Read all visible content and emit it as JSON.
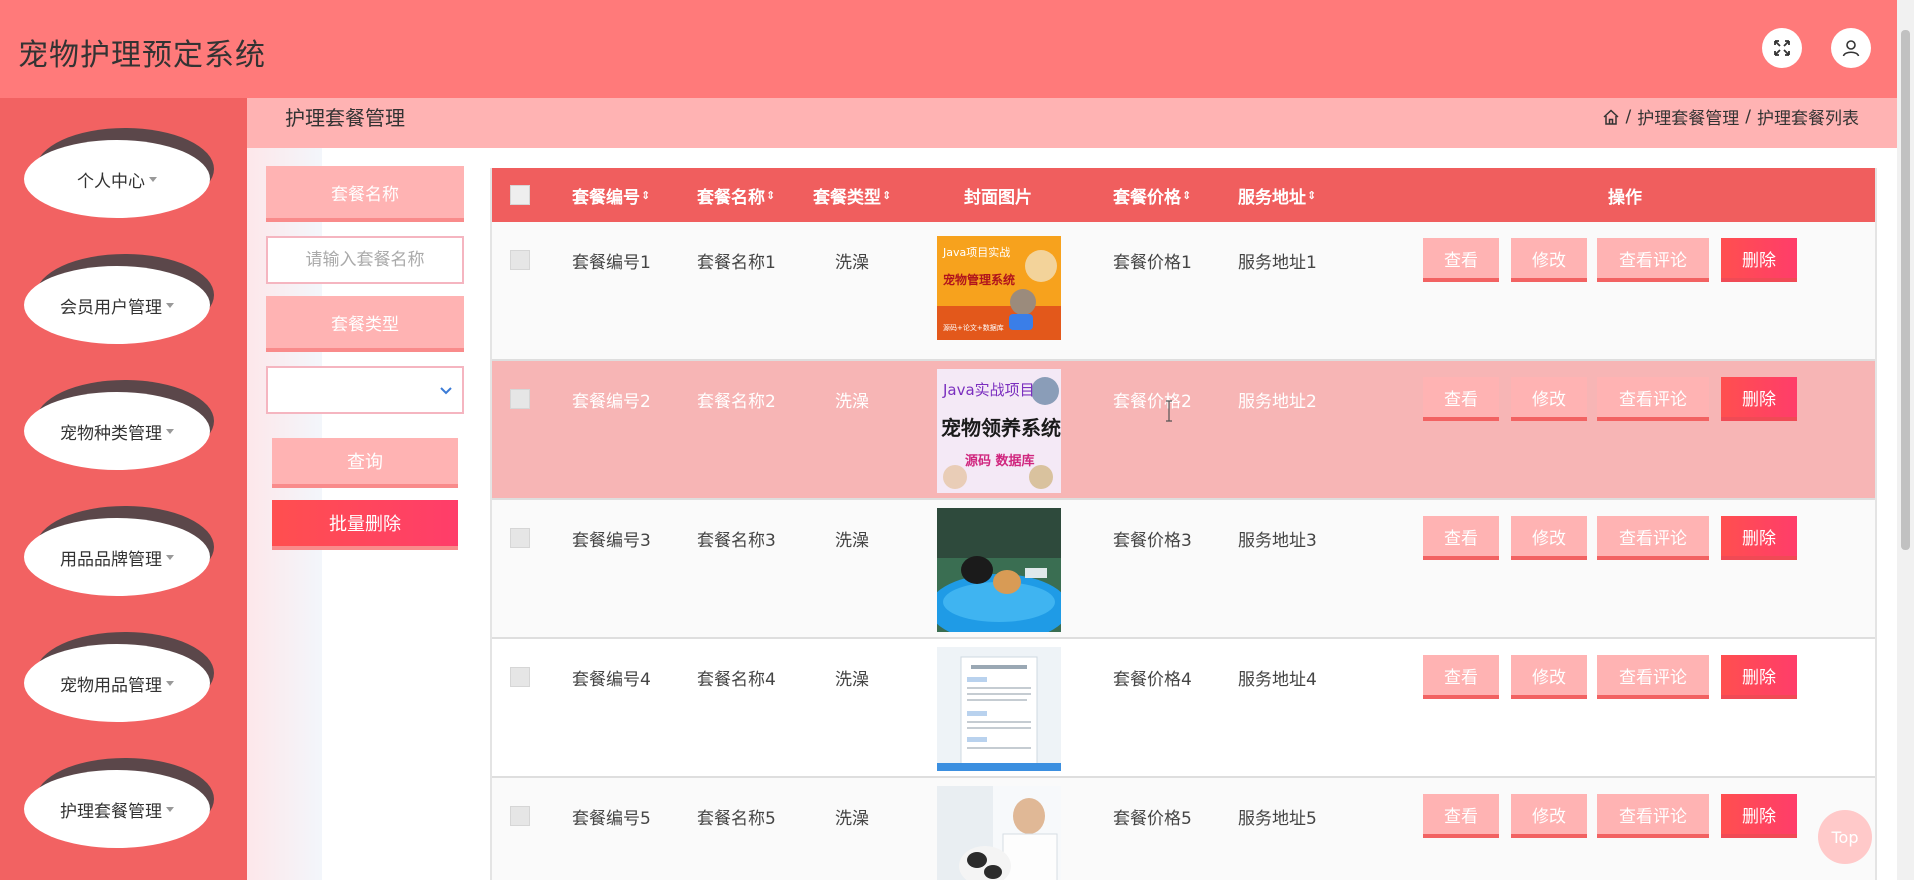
{
  "app": {
    "title": "宠物护理预定系统"
  },
  "header": {
    "fullscreen_icon": "fullscreen-icon",
    "user_icon": "user-icon"
  },
  "sidebar": {
    "items": [
      {
        "label": "个人中心"
      },
      {
        "label": "会员用户管理"
      },
      {
        "label": "宠物种类管理"
      },
      {
        "label": "用品品牌管理"
      },
      {
        "label": "宠物用品管理"
      },
      {
        "label": "护理套餐管理"
      }
    ]
  },
  "pagebar": {
    "title": "护理套餐管理",
    "breadcrumb": [
      "护理套餐管理",
      "护理套餐列表"
    ],
    "separator": "/"
  },
  "search": {
    "name_label": "套餐名称",
    "name_placeholder": "请输入套餐名称",
    "name_value": "",
    "type_label": "套餐类型",
    "type_value": "",
    "query_label": "查询",
    "batch_delete_label": "批量删除"
  },
  "table": {
    "columns": {
      "code": "套餐编号",
      "name": "套餐名称",
      "type": "套餐类型",
      "cover": "封面图片",
      "price": "套餐价格",
      "address": "服务地址",
      "ops": "操作"
    },
    "sort_symbol": "⇕",
    "rows": [
      {
        "code": "套餐编号1",
        "name": "套餐名称1",
        "type": "洗澡",
        "price": "套餐价格1",
        "address": "服务地址1",
        "cover_text_1": "Java项目实战",
        "cover_text_2": "宠物管理系统",
        "cover_text_3": "源码+论文+数据库"
      },
      {
        "code": "套餐编号2",
        "name": "套餐名称2",
        "type": "洗澡",
        "price": "套餐价格2",
        "address": "服务地址2",
        "cover_text_1": "Java实战项目",
        "cover_text_2": "宠物领养系统",
        "cover_text_3": "源码 数据库"
      },
      {
        "code": "套餐编号3",
        "name": "套餐名称3",
        "type": "洗澡",
        "price": "套餐价格3",
        "address": "服务地址3"
      },
      {
        "code": "套餐编号4",
        "name": "套餐名称4",
        "type": "洗澡",
        "price": "套餐价格4",
        "address": "服务地址4"
      },
      {
        "code": "套餐编号5",
        "name": "套餐名称5",
        "type": "洗澡",
        "price": "套餐价格5",
        "address": "服务地址5"
      }
    ],
    "actions": {
      "view": "查看",
      "edit": "修改",
      "review": "查看评论",
      "delete": "删除"
    }
  },
  "top_button": "Top",
  "colors": {
    "header": "#ff7a7a",
    "sidebar": "#f26262",
    "pagebar": "#ffb3b3",
    "table_header": "#f05e5e",
    "row_hover": "#f7b5b5",
    "delete_button": "#ff4f4f"
  }
}
